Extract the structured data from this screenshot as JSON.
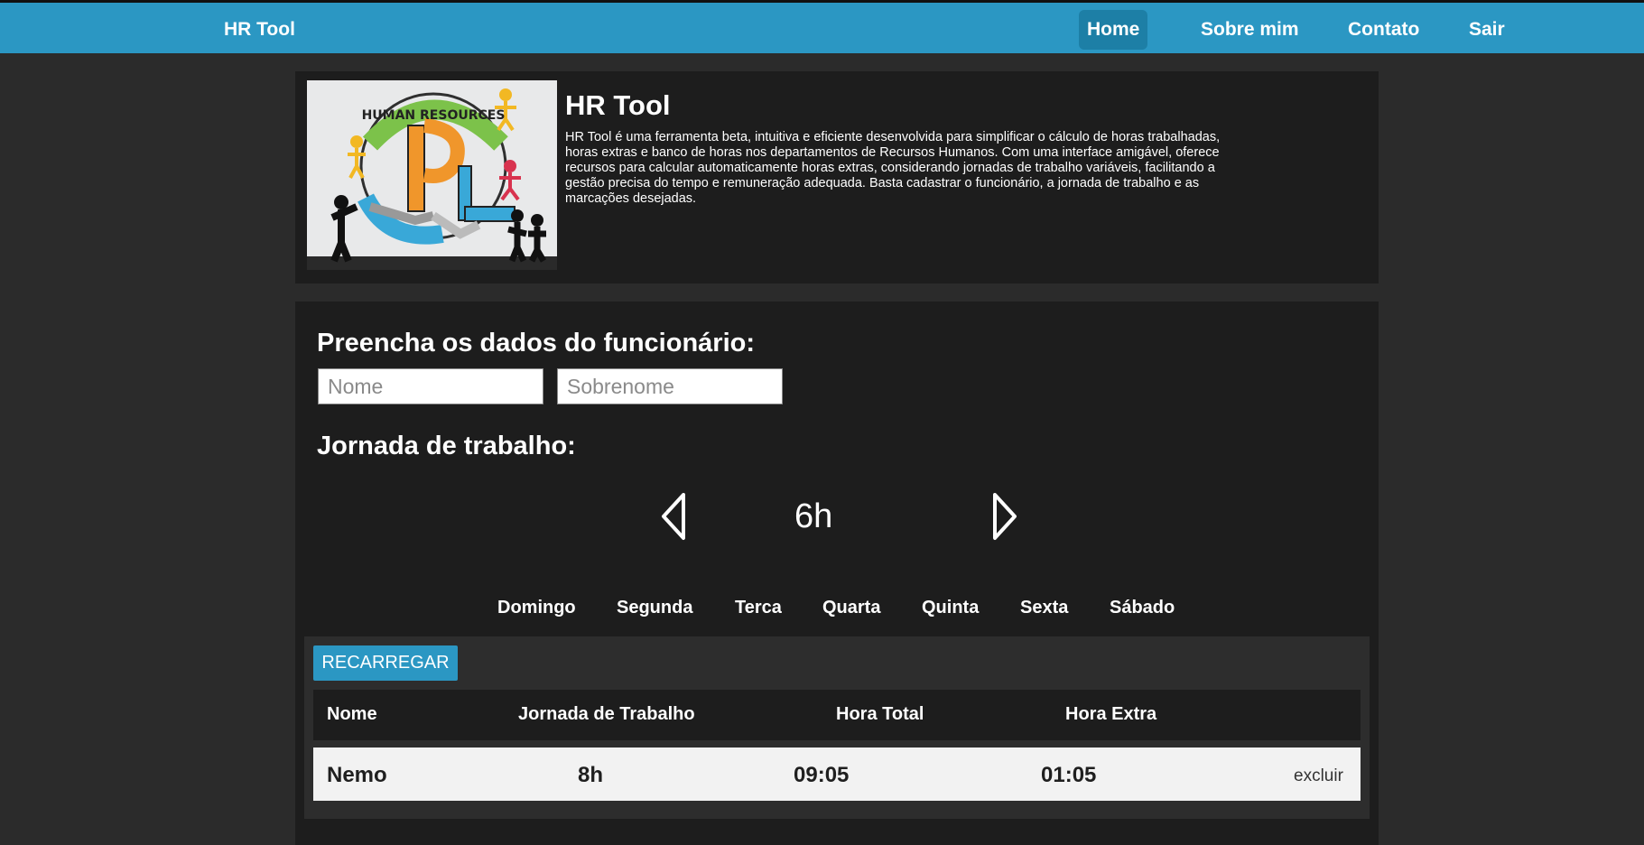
{
  "navbar": {
    "brand": "HR Tool",
    "links": [
      "Home",
      "Sobre mim",
      "Contato",
      "Sair"
    ],
    "active": "Home",
    "color": "#2b97c3"
  },
  "about": {
    "title": "HR Tool",
    "text": "HR Tool é uma ferramenta beta, intuitiva e eficiente desenvolvida para simplificar o cálculo de horas trabalhadas, horas extras e banco de horas nos departamentos de Recursos Humanos. Com uma interface amigável, oferece recursos para calcular automaticamente horas extras, considerando jornadas de trabalho variáveis, facilitando a gestão precisa do tempo e remuneração adequada. Basta cadastrar o funcionário, a jornada de trabalho e as marcações desejadas.",
    "image_text": "HUMAN RESOURCES"
  },
  "form": {
    "title": "Preencha os dados do funcionário:",
    "first_name_placeholder": "Nome",
    "last_name_placeholder": "Sobrenome",
    "schedule_title": "Jornada de trabalho:",
    "hours": "6h",
    "days": [
      "Domingo",
      "Segunda",
      "Terca",
      "Quarta",
      "Quinta",
      "Sexta",
      "Sábado"
    ]
  },
  "table": {
    "reload_label": "RECARREGAR",
    "headers": [
      "Nome",
      "Jornada de Trabalho",
      "Hora Total",
      "Hora Extra"
    ],
    "rows": [
      {
        "nome": "Nemo",
        "jornada": "8h",
        "total": "09:05",
        "extra": "01:05",
        "action": "excluir"
      }
    ]
  }
}
